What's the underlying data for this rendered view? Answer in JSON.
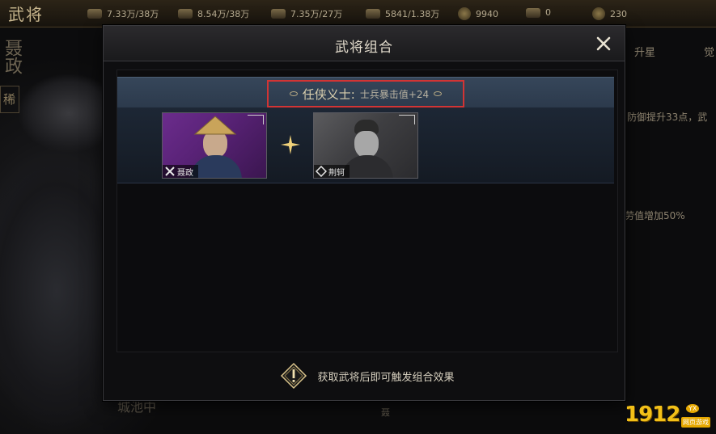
{
  "game": {
    "title": "武将",
    "resources": [
      {
        "icon": "food-icon",
        "value": "7.33万/38万"
      },
      {
        "icon": "wood-icon",
        "value": "8.54万/38万"
      },
      {
        "icon": "stone-icon",
        "value": "7.35万/27万"
      },
      {
        "icon": "iron-icon",
        "value": "5841/1.38万"
      },
      {
        "icon": "copper-coin-icon",
        "value": "9940"
      },
      {
        "icon": "token-icon",
        "value": "0"
      },
      {
        "icon": "gem-icon",
        "value": "230"
      }
    ],
    "left_hero_name": "聂政",
    "left_tag": "稀",
    "right_tab_upgrade": "升星",
    "right_tab_other": "觉",
    "right_text_1": "防御提升33点，武",
    "right_text_2": "劳值增加50%",
    "bottom_left_text": "城池中",
    "bottom_mid_glyph": "聂"
  },
  "dialog": {
    "title": "武将组合",
    "combo": {
      "name": "任侠义士:",
      "effect": "士兵暴击值+24",
      "heroes": [
        {
          "name": "聂政",
          "owned": true,
          "rarity_color": "#6b2c8c"
        },
        {
          "name": "荆轲",
          "owned": false,
          "rarity_color": "#5b5b5e"
        }
      ]
    },
    "footer_note": "获取武将后即可触发组合效果"
  },
  "watermark": {
    "number": "1912",
    "sub": "网页游戏",
    "badge": "YX"
  }
}
